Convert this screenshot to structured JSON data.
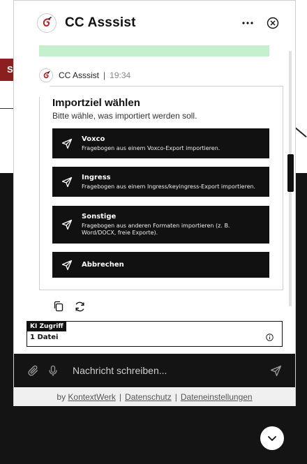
{
  "background": {
    "red_tab_label": "S"
  },
  "widget": {
    "title": "CC Asssist",
    "menu_icon": "more-horizontal-icon",
    "close_icon": "close-circle-icon"
  },
  "message": {
    "sender": "CC Asssist",
    "time": "19:34",
    "card": {
      "title": "Importziel wählen",
      "subtitle": "Bitte wähle, was importiert werden soll.",
      "options": [
        {
          "label": "Voxco",
          "description": "Fragebogen aus einem Voxco-Export importieren."
        },
        {
          "label": "Ingress",
          "description": "Fragebogen aus einem Ingress/keyingress-Export importieren."
        },
        {
          "label": "Sonstige",
          "description": "Fragebogen aus anderen Formaten importieren (z. B. Word/DOCX, freie Exporte)."
        },
        {
          "label": "Abbrechen",
          "description": ""
        }
      ]
    }
  },
  "ki_access": {
    "tag": "KI Zugriff",
    "files": "1 Datei"
  },
  "composer": {
    "placeholder": "Nachricht schreiben..."
  },
  "footer": {
    "by": "by",
    "brand": "KontextWerk",
    "privacy": "Datenschutz",
    "file_settings": "Dateneinstellungen"
  },
  "colors": {
    "accent_dark": "#111111",
    "success_bg": "#c5f0cd",
    "brand_red": "#8b1e1e"
  }
}
